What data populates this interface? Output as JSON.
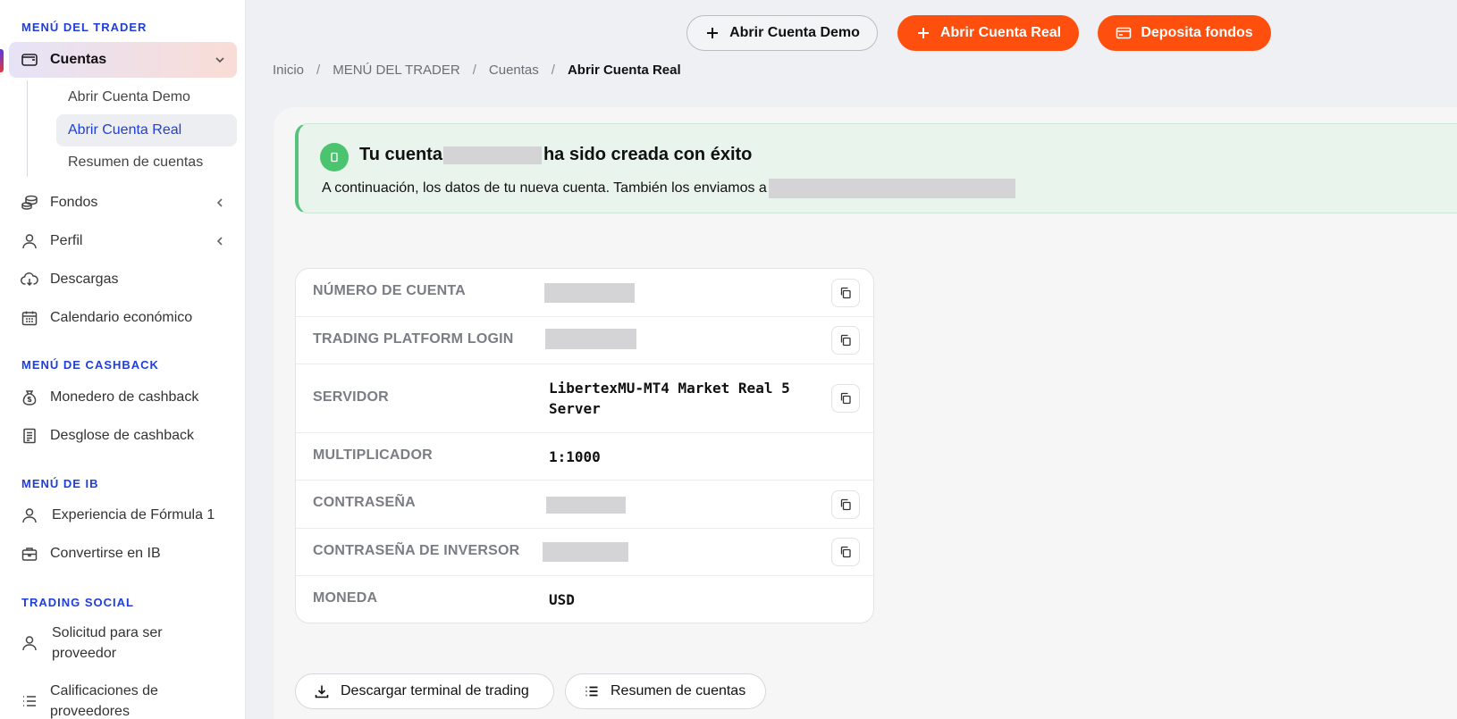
{
  "sidebar": {
    "sections": {
      "trader": "MENÚ DEL TRADER",
      "cashback": "MENÚ DE CASHBACK",
      "ib": "MENÚ DE IB",
      "social": "TRADING SOCIAL"
    },
    "cuentas": {
      "label": "Cuentas",
      "icon": "wallet-icon",
      "sub": [
        "Abrir Cuenta Demo",
        "Abrir Cuenta Real",
        "Resumen de cuentas"
      ]
    },
    "items": [
      {
        "label": "Fondos",
        "icon": "coins-icon"
      },
      {
        "label": "Perfil",
        "icon": "user-icon"
      },
      {
        "label": "Descargas",
        "icon": "cloud-download-icon"
      },
      {
        "label": "Calendario económico",
        "icon": "calendar-icon"
      },
      {
        "label": "Monedero de cashback",
        "icon": "money-bag-icon"
      },
      {
        "label": "Desglose de cashback",
        "icon": "receipt-icon"
      },
      {
        "label": "Experiencia de Fórmula 1",
        "icon": "user-icon"
      },
      {
        "label": "Convertirse en IB",
        "icon": "briefcase-icon"
      },
      {
        "label": "Solicitud para ser proveedor",
        "icon": "user-icon"
      },
      {
        "label": "Calificaciones de proveedores",
        "icon": "list-icon"
      }
    ]
  },
  "topbar": {
    "demo_label": "Abrir Cuenta Demo",
    "real_label": "Abrir Cuenta Real",
    "deposit_label": "Deposita fondos"
  },
  "breadcrumb": {
    "items": [
      "Inicio",
      "MENÚ DEL TRADER",
      "Cuentas",
      "Abrir Cuenta Real"
    ],
    "separator": "/"
  },
  "success": {
    "title_before": "Tu cuenta",
    "title_after": "ha sido creada con éxito",
    "message": "A continuación, los datos de tu nueva cuenta. También los enviamos a"
  },
  "details": [
    {
      "label": "NÚMERO DE CUENTA",
      "value": "",
      "copy": true
    },
    {
      "label": "TRADING PLATFORM LOGIN",
      "value": "",
      "copy": true
    },
    {
      "label": "SERVIDOR",
      "value": "LibertexMU-MT4 Market Real 5 Server",
      "copy": true
    },
    {
      "label": "MULTIPLICADOR",
      "value": "1:1000",
      "copy": false
    },
    {
      "label": "CONTRASEÑA",
      "value": "",
      "copy": true
    },
    {
      "label": "CONTRASEÑA DE INVERSOR",
      "value": "",
      "copy": true
    },
    {
      "label": "MONEDA",
      "value": "USD",
      "copy": false
    }
  ],
  "actions": {
    "download_label": "Descargar terminal de trading",
    "summary_label": "Resumen de cuentas"
  },
  "colors": {
    "accent_orange": "#ff4f0f",
    "brand_blue": "#1f3fd8",
    "success_green": "#4cc46f"
  }
}
